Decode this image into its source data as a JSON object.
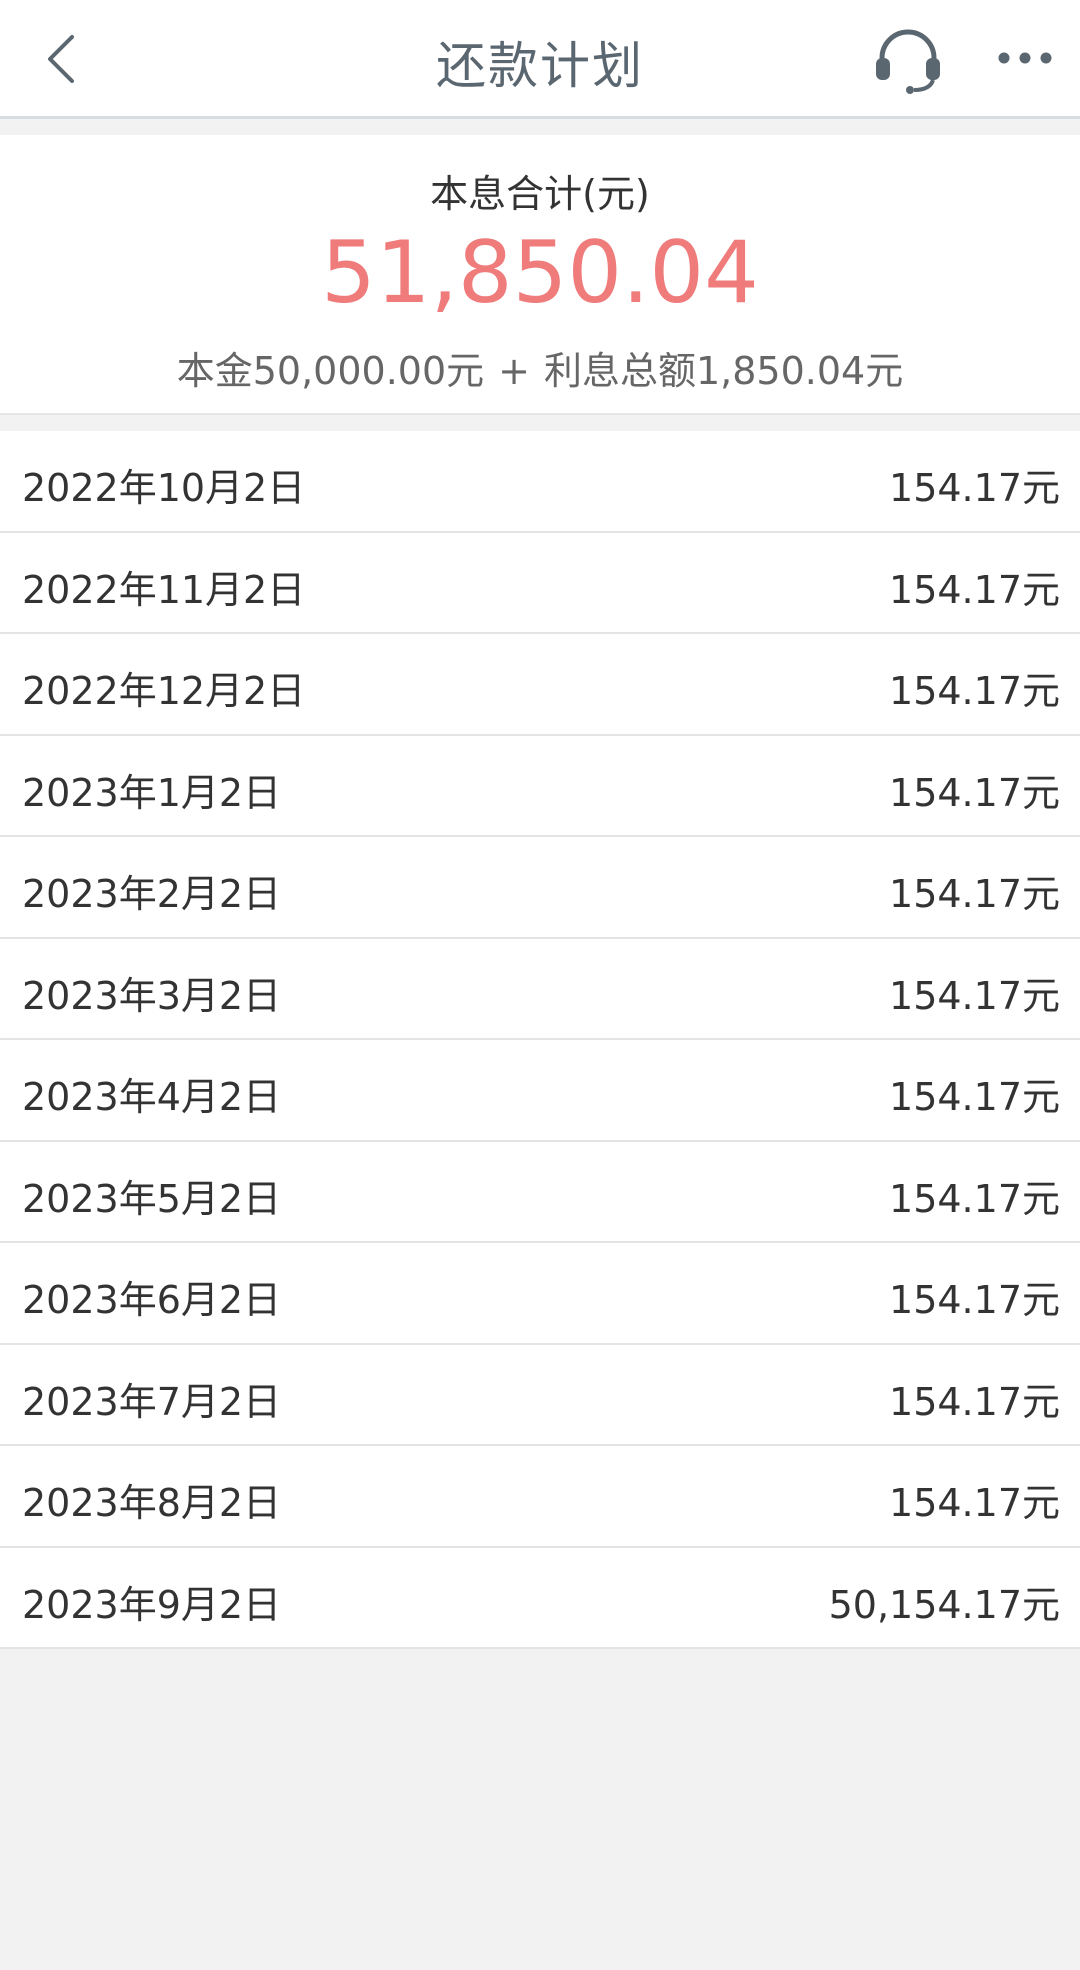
{
  "header": {
    "title": "还款计划",
    "back_icon": "chevron-left-icon",
    "support_icon": "headset-icon",
    "more_icon": "more-horizontal-icon"
  },
  "summary": {
    "label": "本息合计(元)",
    "total": "51,850.04",
    "principal_text": "本金50,000.00元",
    "plus": "+",
    "interest_text": "利息总额1,850.04元"
  },
  "colors": {
    "accent": "#ef7b7b",
    "title": "#5b6770",
    "text": "#333333",
    "background": "#f2f2f2"
  },
  "schedule": [
    {
      "date": "2022年10月2日",
      "amount": "154.17元"
    },
    {
      "date": "2022年11月2日",
      "amount": "154.17元"
    },
    {
      "date": "2022年12月2日",
      "amount": "154.17元"
    },
    {
      "date": "2023年1月2日",
      "amount": "154.17元"
    },
    {
      "date": "2023年2月2日",
      "amount": "154.17元"
    },
    {
      "date": "2023年3月2日",
      "amount": "154.17元"
    },
    {
      "date": "2023年4月2日",
      "amount": "154.17元"
    },
    {
      "date": "2023年5月2日",
      "amount": "154.17元"
    },
    {
      "date": "2023年6月2日",
      "amount": "154.17元"
    },
    {
      "date": "2023年7月2日",
      "amount": "154.17元"
    },
    {
      "date": "2023年8月2日",
      "amount": "154.17元"
    },
    {
      "date": "2023年9月2日",
      "amount": "50,154.17元"
    }
  ]
}
